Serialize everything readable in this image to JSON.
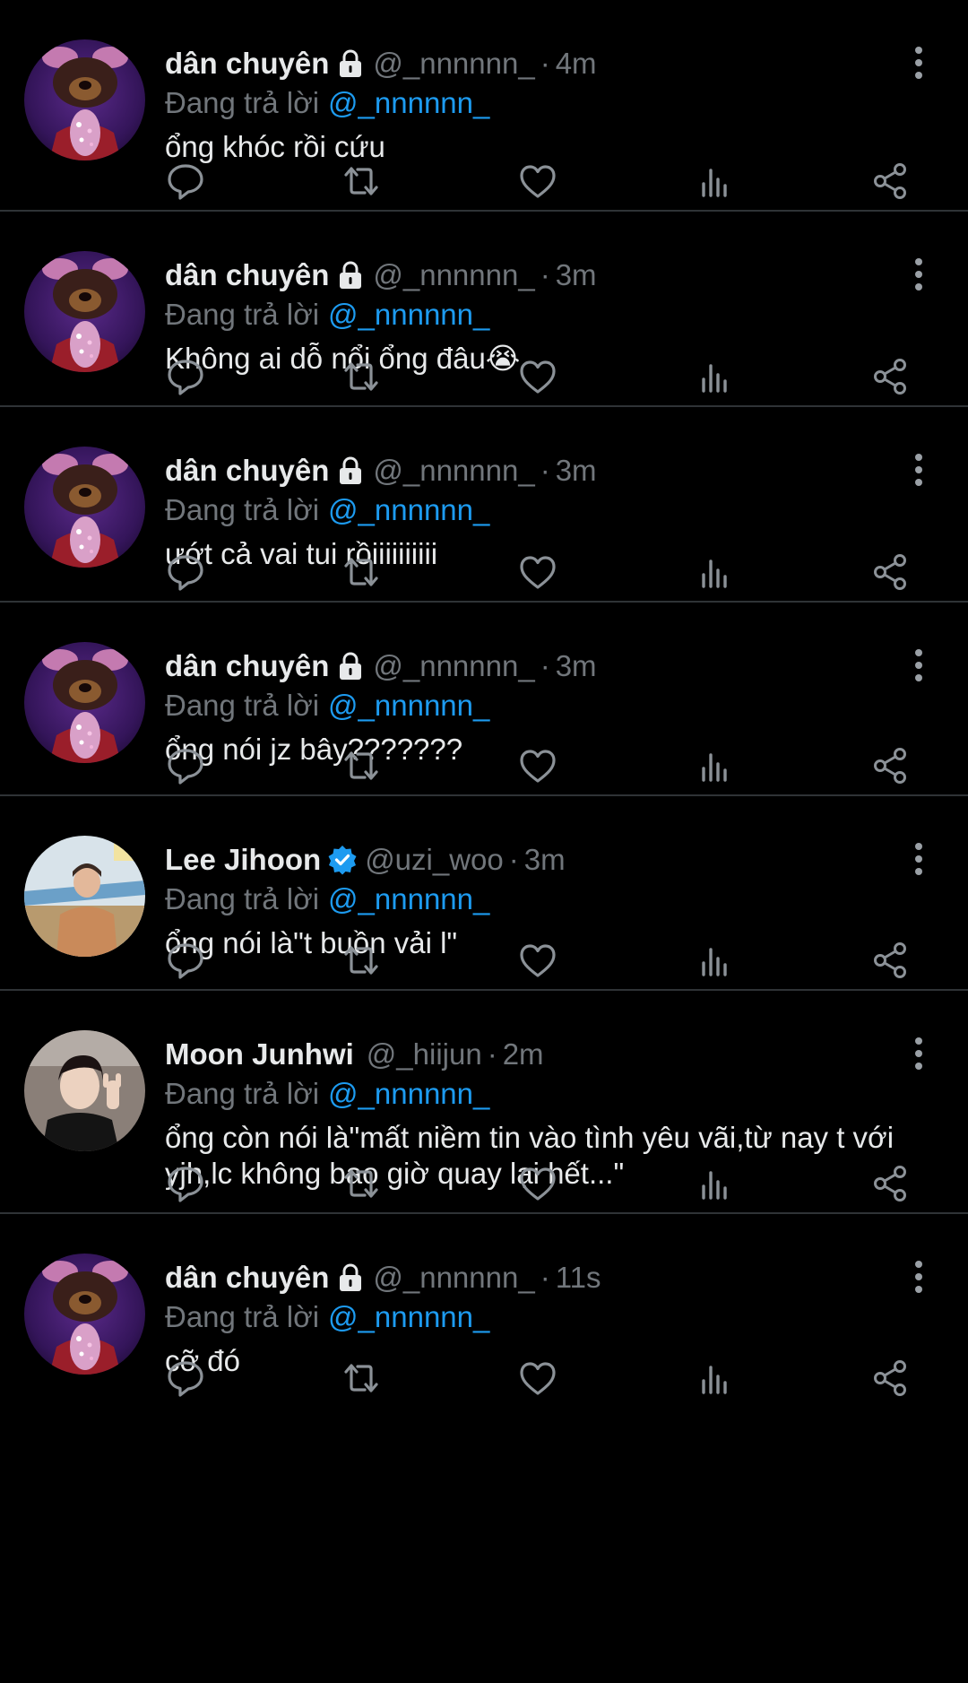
{
  "colors": {
    "background": "#000000",
    "divider": "#2f3336",
    "primary_text": "#e7e9ea",
    "secondary_text": "#71767b",
    "accent": "#1d9bf0"
  },
  "tweets": [
    {
      "author_name": "dân chuyên",
      "badge": "lock-icon",
      "handle": "@_nnnnnn_",
      "separator": "·",
      "time": "4m",
      "reply_prefix": "Đang trả lời",
      "reply_target": "@_nnnnnn_",
      "text": "ổng khóc rồi cứu",
      "avatar": "avatar-dog-filter"
    },
    {
      "author_name": "dân chuyên",
      "badge": "lock-icon",
      "handle": "@_nnnnnn_",
      "separator": "·",
      "time": "3m",
      "reply_prefix": "Đang trả lời",
      "reply_target": "@_nnnnnn_",
      "text": "Không ai dỗ nổi ổng đâu😭",
      "avatar": "avatar-dog-filter"
    },
    {
      "author_name": "dân chuyên",
      "badge": "lock-icon",
      "handle": "@_nnnnnn_",
      "separator": "·",
      "time": "3m",
      "reply_prefix": "Đang trả lời",
      "reply_target": "@_nnnnnn_",
      "text": "ướt cả vai tui rồiiiiiiiiii",
      "avatar": "avatar-dog-filter"
    },
    {
      "author_name": "dân chuyên",
      "badge": "lock-icon",
      "handle": "@_nnnnnn_",
      "separator": "·",
      "time": "3m",
      "reply_prefix": "Đang trả lời",
      "reply_target": "@_nnnnnn_",
      "text": "ổng nói jz bây???????",
      "avatar": "avatar-dog-filter"
    },
    {
      "author_name": "Lee Jihoon",
      "badge": "verified-icon",
      "handle": "@uzi_woo",
      "separator": "·",
      "time": "3m",
      "reply_prefix": "Đang trả lời",
      "reply_target": "@_nnnnnn_",
      "text": "ổng nói là\"t buồn vải l\"",
      "avatar": "avatar-person-outdoor"
    },
    {
      "author_name": "Moon Junhwi",
      "badge": "",
      "handle": "@_hiijun",
      "separator": "·",
      "time": "2m",
      "reply_prefix": "Đang trả lời",
      "reply_target": "@_nnnnnn_",
      "text": "ổng còn nói là\"mất niềm tin vào tình yêu vãi,từ nay t với yjh,lc không bao giờ quay lại hết...\"",
      "avatar": "avatar-person-selfie"
    },
    {
      "author_name": "dân chuyên",
      "badge": "lock-icon",
      "handle": "@_nnnnnn_",
      "separator": "·",
      "time": "11s",
      "reply_prefix": "Đang trả lời",
      "reply_target": "@_nnnnnn_",
      "text": "cỡ đó",
      "avatar": "avatar-dog-filter"
    }
  ],
  "action_icons": [
    "reply-icon",
    "retweet-icon",
    "like-icon",
    "views-icon",
    "share-icon"
  ],
  "more_icon": "more-options-icon"
}
